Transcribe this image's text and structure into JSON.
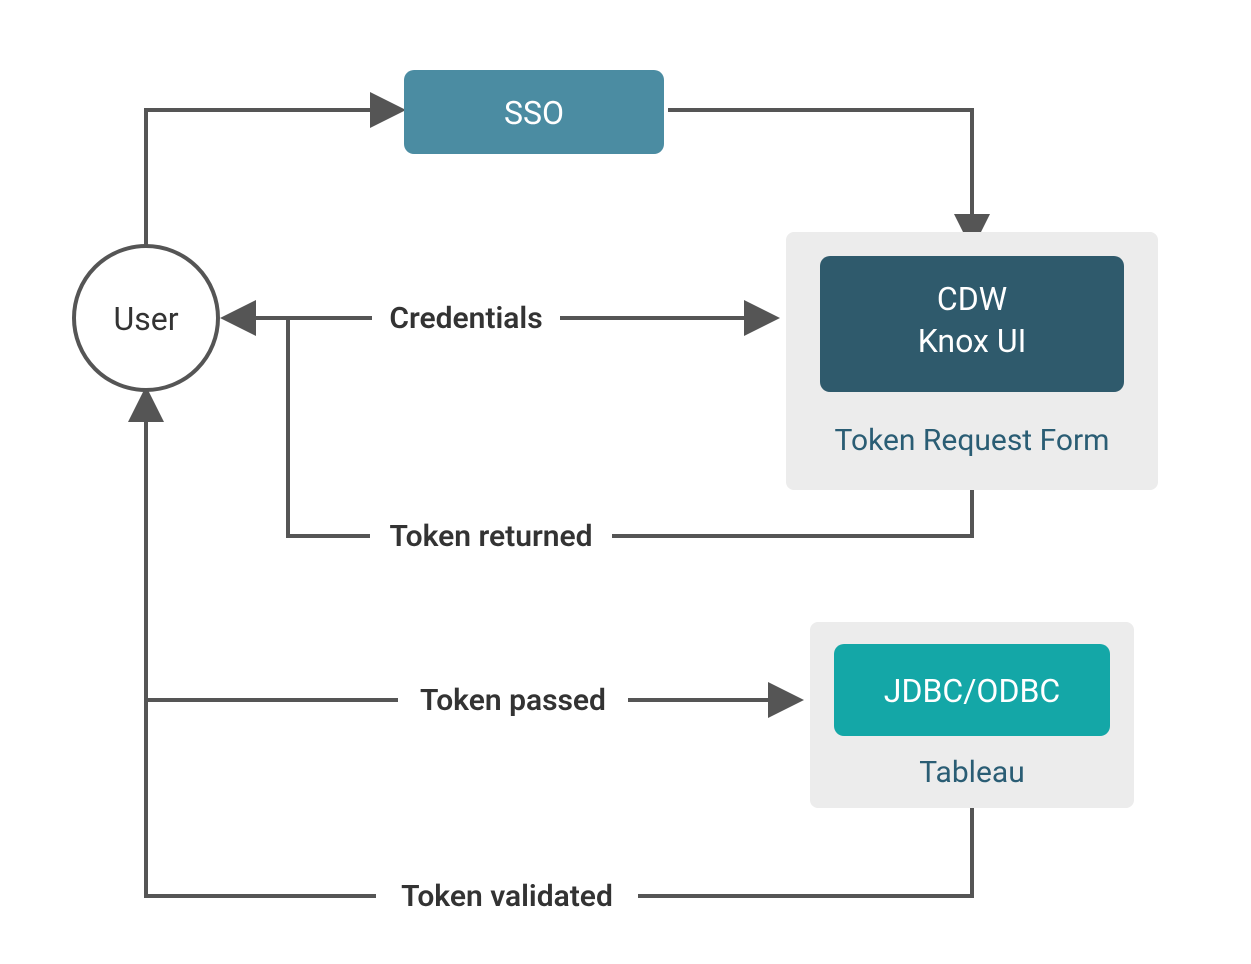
{
  "diagram": {
    "nodes": {
      "user": {
        "label": "User"
      },
      "sso": {
        "label": "SSO"
      },
      "knox": {
        "label_line1": "CDW",
        "label_line2": "Knox UI"
      },
      "token_form": {
        "caption": "Token Request Form"
      },
      "jdbc": {
        "label": "JDBC/ODBC"
      },
      "tableau": {
        "caption": "Tableau"
      }
    },
    "edges": {
      "credentials": {
        "label": "Credentials"
      },
      "token_returned": {
        "label": "Token returned"
      },
      "token_passed": {
        "label": "Token passed"
      },
      "token_validated": {
        "label": "Token validated"
      }
    },
    "colors": {
      "sso_fill": "#4b8ca2",
      "knox_fill": "#2f5a6c",
      "jdbc_fill": "#14a7a7",
      "panel_fill": "#ececec",
      "stroke": "#555555",
      "caption_color": "#2a5d74"
    }
  }
}
